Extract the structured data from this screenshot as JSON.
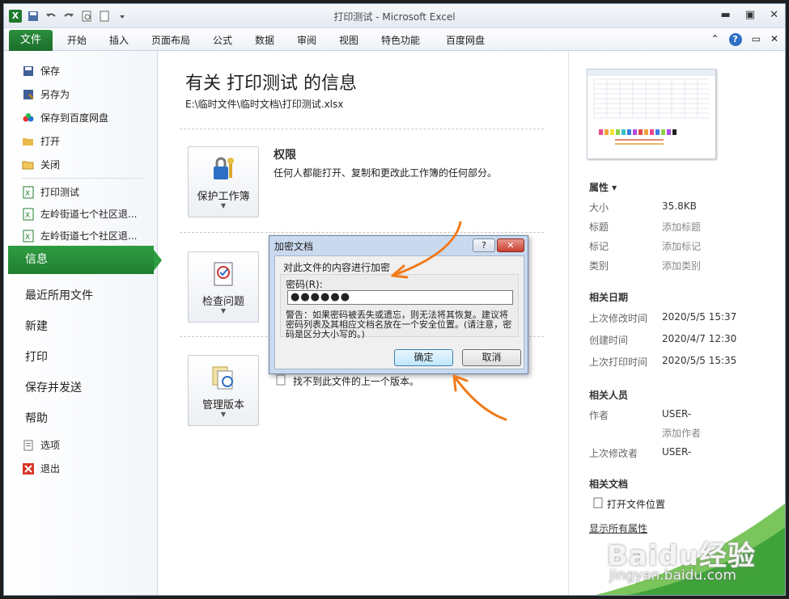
{
  "window": {
    "title": "打印测试 - Microsoft Excel",
    "app_icon": "X"
  },
  "ribbon": {
    "file_tab": "文件",
    "tabs": [
      "开始",
      "插入",
      "页面布局",
      "公式",
      "数据",
      "审阅",
      "视图",
      "特色功能",
      "百度网盘"
    ]
  },
  "nav": {
    "items_top": [
      "保存",
      "另存为",
      "保存到百度网盘",
      "打开",
      "关闭"
    ],
    "recent": [
      "打印测试",
      "左岭街道七个社区退...",
      "左岭街道七个社区退..."
    ],
    "info": "信息",
    "big": [
      "最近所用文件",
      "新建",
      "打印",
      "保存并发送",
      "帮助"
    ],
    "bottom": [
      "选项",
      "退出"
    ]
  },
  "main": {
    "title": "有关 打印测试 的信息",
    "path": "E:\\临时文件\\临时文档\\打印测试.xlsx",
    "protect_label": "保护工作簿",
    "perm_heading": "权限",
    "perm_desc": "任何人都能打开、复制和更改此工作簿的任何部分。",
    "check_label": "检查问题",
    "versions_label": "管理版本",
    "versions_desc": "找不到此文件的上一个版本。"
  },
  "side": {
    "props_heading": "属性 ▾",
    "props": [
      {
        "label": "大小",
        "value": "35.8KB"
      },
      {
        "label": "标题",
        "value": "添加标题"
      },
      {
        "label": "标记",
        "value": "添加标记"
      },
      {
        "label": "类别",
        "value": "添加类别"
      }
    ],
    "dates_heading": "相关日期",
    "dates": [
      {
        "label": "上次修改时间",
        "value": "2020/5/5 15:37"
      },
      {
        "label": "创建时间",
        "value": "2020/4/7 12:30"
      },
      {
        "label": "上次打印时间",
        "value": "2020/5/5 15:35"
      }
    ],
    "people_heading": "相关人员",
    "author_label": "作者",
    "author_value": "USER-",
    "add_author": "添加作者",
    "lastmod_label": "上次修改者",
    "lastmod_value": "USER-",
    "docs_heading": "相关文档",
    "open_location": "打开文件位置",
    "show_all": "显示所有属性"
  },
  "dialog": {
    "title": "加密文档",
    "help": "?",
    "close": "✕",
    "prompt": "对此文件的内容进行加密",
    "pw_label": "密码(R):",
    "pw_value": "●●●●●●",
    "warning": "警告：如果密码被丢失或遗忘，则无法将其恢复。建议将密码列表及其相应文档名放在一个安全位置。(请注意，密码是区分大小写的。)",
    "ok": "确定",
    "cancel": "取消"
  },
  "watermark": {
    "brand": "Baidu经验",
    "url": "jingyan.baidu.com"
  },
  "colors": {
    "accent": "#1f7f31",
    "annotation": "#f07a1a"
  }
}
